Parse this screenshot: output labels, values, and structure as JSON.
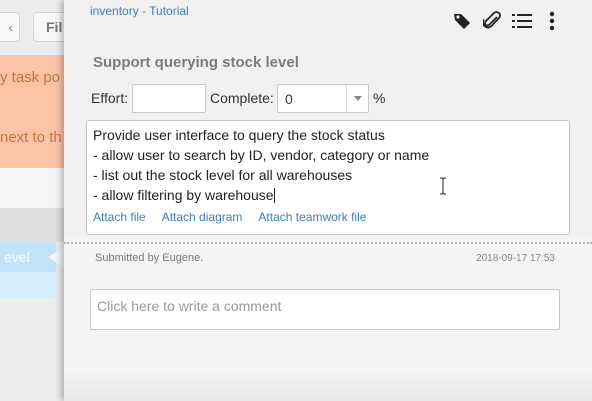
{
  "background": {
    "button_a_text": "‹",
    "button_b_text": "Fil",
    "card_line1": "y task po",
    "card_line2": "next to th",
    "lane_tab_text": "evel"
  },
  "panel": {
    "breadcrumb": "inventory - Tutorial",
    "toolbar_icons": [
      "tag-icon",
      "paperclip-icon",
      "list-icon",
      "more-vertical-icon"
    ],
    "title": "Support querying stock level",
    "effort_label": "Effort:",
    "effort_value": "",
    "complete_label": "Complete:",
    "complete_value": "0",
    "percent_symbol": "%",
    "description_lines": [
      "Provide user interface to query the stock status",
      "- allow user to search by ID, vendor, category or name",
      "- list out the stock level for all warehouses",
      "- allow filtering by warehouse"
    ],
    "attach_links": [
      "Attach file",
      "Attach diagram",
      "Attach teamwork file"
    ],
    "submitted_by": "Submitted by Eugene.",
    "submitted_date": "2018-09-17 17:53",
    "comment_placeholder": "Click here to write a comment"
  },
  "colors": {
    "link": "#3a7fc1",
    "card_bg": "#fcc4a7",
    "lane_tab": "#bfe3fb"
  }
}
